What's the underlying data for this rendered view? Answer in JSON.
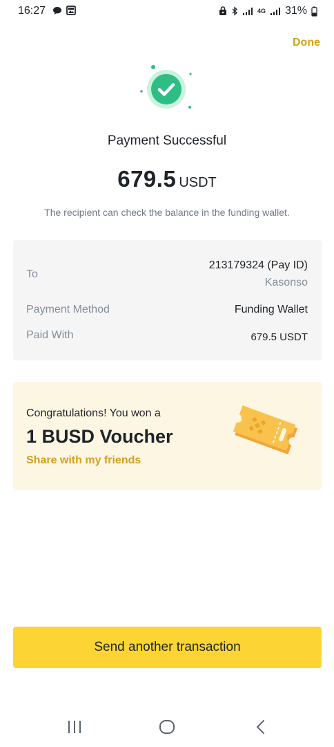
{
  "status_bar": {
    "time": "16:27",
    "battery": "31%",
    "network": "4G",
    "icons": [
      "chat-bubble-icon",
      "image-icon",
      "lock-icon",
      "bluetooth-icon",
      "signal-icon",
      "battery-icon"
    ]
  },
  "header": {
    "done_label": "Done"
  },
  "result": {
    "icon": "checkmark-circle-icon",
    "title": "Payment Successful",
    "amount": "679.5",
    "currency": "USDT",
    "notice": "The recipient can check the balance in the funding wallet."
  },
  "details": {
    "to_label": "To",
    "to_value": "213179324 (Pay ID)",
    "to_name": "Kasonso",
    "method_label": "Payment Method",
    "method_value": "Funding Wallet",
    "paid_label": "Paid With",
    "paid_value": "679.5 USDT"
  },
  "voucher": {
    "congrats": "Congratulations! You won a",
    "title": "1 BUSD Voucher",
    "share_label": "Share with my friends",
    "icon": "voucher-ticket-icon"
  },
  "actions": {
    "send_label": "Send another transaction"
  },
  "nav": {
    "icons": [
      "recent-apps-icon",
      "home-icon",
      "back-icon"
    ]
  },
  "colors": {
    "accent": "#d3a11a",
    "button": "#fcd535",
    "success": "#2ebd85",
    "card": "#f5f5f5",
    "voucher_bg": "#fdf6e3"
  }
}
